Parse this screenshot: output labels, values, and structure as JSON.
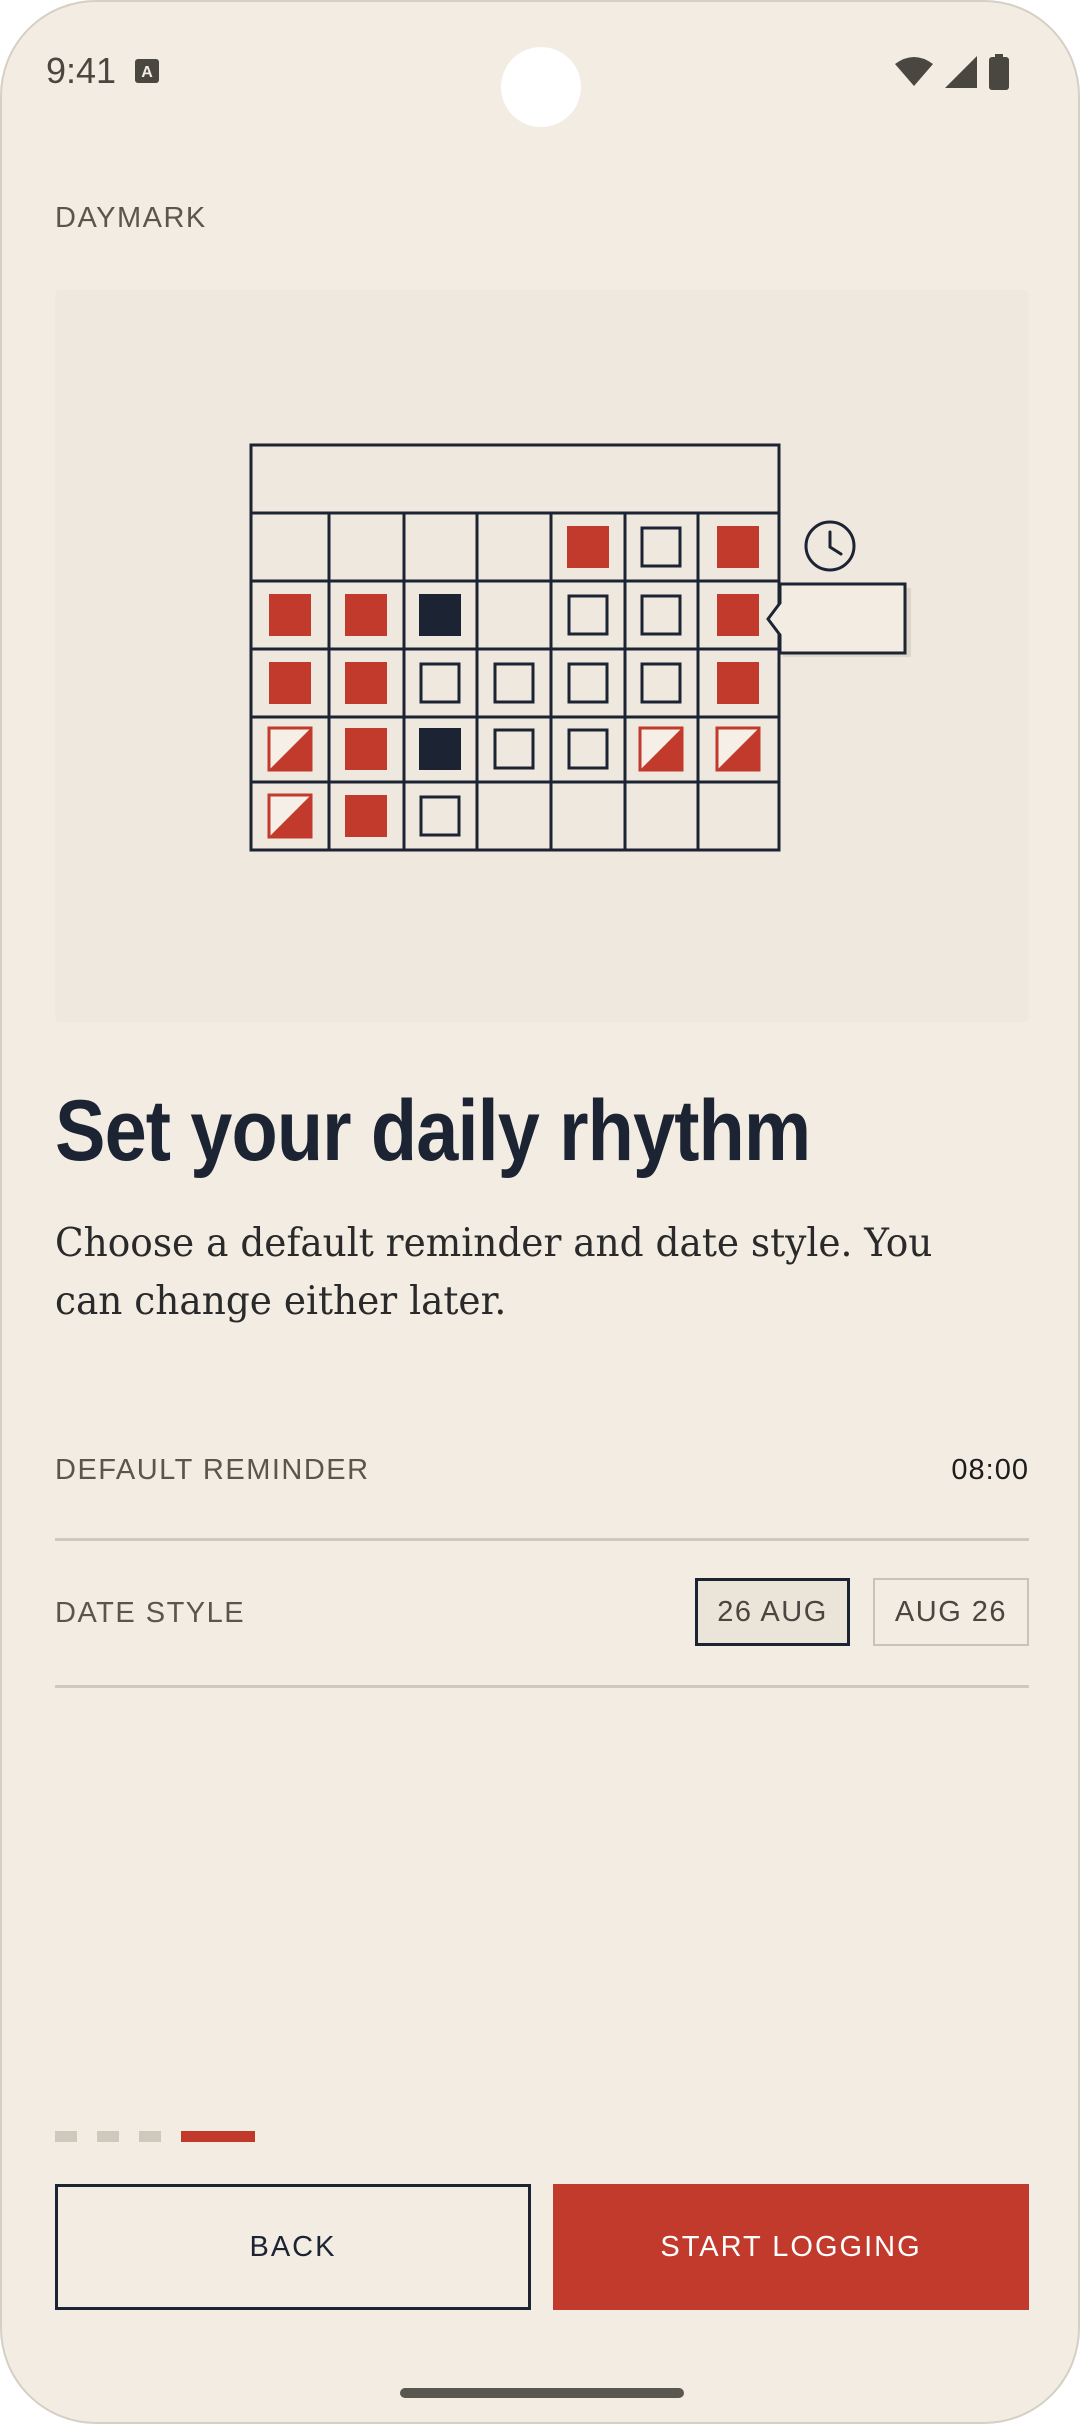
{
  "status_bar": {
    "time": "9:41",
    "icons": [
      "a-notification-icon",
      "wifi-icon",
      "signal-icon",
      "battery-icon"
    ]
  },
  "app": {
    "name": "DAYMARK"
  },
  "illustration": {
    "icons": [
      "calendar-grid-icon",
      "clock-icon",
      "reminder-flag-icon"
    ],
    "colors": {
      "accent": "#c23a2c",
      "ink": "#1c2433"
    },
    "calendar": {
      "rows": [
        [
          "empty",
          "empty",
          "empty",
          "empty",
          "red",
          "outline",
          "red"
        ],
        [
          "red",
          "red",
          "navy",
          "empty",
          "outline",
          "outline",
          "red"
        ],
        [
          "red",
          "red",
          "outline",
          "outline",
          "outline",
          "outline",
          "red"
        ],
        [
          "half",
          "red",
          "navy",
          "outline",
          "outline",
          "half",
          "half"
        ],
        [
          "half",
          "red",
          "outline",
          "empty",
          "empty",
          "empty",
          "empty"
        ]
      ]
    }
  },
  "content": {
    "title": "Set your daily rhythm",
    "subtitle": "Choose a default reminder and date style. You can change either later."
  },
  "settings": {
    "reminder_label": "DEFAULT REMINDER",
    "reminder_value": "08:00",
    "date_style_label": "DATE STYLE",
    "date_style_options": [
      "26 AUG",
      "AUG 26"
    ],
    "date_style_selected": "26 AUG"
  },
  "pager": {
    "total": 4,
    "current": 4
  },
  "buttons": {
    "back": "BACK",
    "start": "START LOGGING"
  },
  "colors": {
    "background": "#f2ece3",
    "accent": "#c23a2c",
    "ink": "#1c2433"
  }
}
